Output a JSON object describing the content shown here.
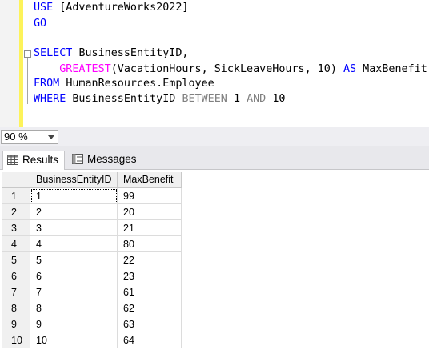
{
  "editor": {
    "lines": [
      {
        "tokens": [
          {
            "t": "USE ",
            "c": "kw"
          },
          {
            "t": "[AdventureWorks2022]",
            "c": ""
          }
        ]
      },
      {
        "tokens": [
          {
            "t": "GO",
            "c": "kw"
          }
        ]
      },
      {
        "tokens": []
      },
      {
        "tokens": [
          {
            "t": "SELECT ",
            "c": "kw"
          },
          {
            "t": "BusinessEntityID,",
            "c": ""
          }
        ]
      },
      {
        "tokens": [
          {
            "t": "    ",
            "c": ""
          },
          {
            "t": "GREATEST",
            "c": "fn"
          },
          {
            "t": "(VacationHours, SickLeaveHours, 10) ",
            "c": ""
          },
          {
            "t": "AS ",
            "c": "kw"
          },
          {
            "t": "MaxBenefit",
            "c": ""
          }
        ]
      },
      {
        "tokens": [
          {
            "t": "FROM ",
            "c": "kw"
          },
          {
            "t": "HumanResources.Employee",
            "c": ""
          }
        ]
      },
      {
        "tokens": [
          {
            "t": "WHERE ",
            "c": "kw"
          },
          {
            "t": "BusinessEntityID ",
            "c": ""
          },
          {
            "t": "BETWEEN ",
            "c": "gr"
          },
          {
            "t": "1 ",
            "c": ""
          },
          {
            "t": "AND ",
            "c": "gr"
          },
          {
            "t": "10",
            "c": ""
          }
        ]
      }
    ]
  },
  "zoom": {
    "value": "90 %"
  },
  "tabs": {
    "results": "Results",
    "messages": "Messages"
  },
  "grid": {
    "columns": [
      "BusinessEntityID",
      "MaxBenefit"
    ],
    "rows": [
      [
        "1",
        "1",
        "99"
      ],
      [
        "2",
        "2",
        "20"
      ],
      [
        "3",
        "3",
        "21"
      ],
      [
        "4",
        "4",
        "80"
      ],
      [
        "5",
        "5",
        "22"
      ],
      [
        "6",
        "6",
        "23"
      ],
      [
        "7",
        "7",
        "61"
      ],
      [
        "8",
        "8",
        "62"
      ],
      [
        "9",
        "9",
        "63"
      ],
      [
        "10",
        "10",
        "64"
      ]
    ]
  }
}
